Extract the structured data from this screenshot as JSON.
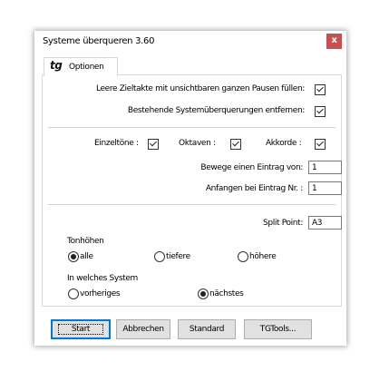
{
  "window": {
    "title": "Systeme überqueren 3.60",
    "close_label": "x"
  },
  "tab": {
    "icon": "tg",
    "label": "Optionen"
  },
  "options": {
    "leere_zieltakte": {
      "label": "Leere Zieltakte mit unsichtbaren ganzen Pausen füllen:",
      "checked": true
    },
    "bestehende": {
      "label": "Bestehende Systemüberquerungen entfernen:",
      "checked": true
    },
    "einzeltoene": {
      "label": "Einzeltöne :",
      "checked": true
    },
    "oktaven": {
      "label": "Oktaven :",
      "checked": true
    },
    "akkorde": {
      "label": "Akkorde :",
      "checked": true
    }
  },
  "fields": {
    "bewege": {
      "label": "Bewege einen Eintrag von:",
      "value": "1"
    },
    "anfangen": {
      "label": "Anfangen bei Eintrag Nr. :",
      "value": "1"
    },
    "split_point": {
      "label": "Split Point:",
      "value": "A3"
    }
  },
  "tonhoehen": {
    "title": "Tonhöhen",
    "options": [
      "alle",
      "tiefere",
      "höhere"
    ],
    "selected": "alle"
  },
  "system": {
    "title": "In welches System",
    "options": [
      "vorheriges",
      "nächstes"
    ],
    "selected": "nächstes"
  },
  "buttons": {
    "start": "Start",
    "abbrechen": "Abbrechen",
    "standard": "Standard",
    "tgtools": "TGTools..."
  },
  "icons": {
    "close": "close-icon",
    "tab": "tg-logo-icon",
    "checkbox": "checkmark-icon"
  }
}
